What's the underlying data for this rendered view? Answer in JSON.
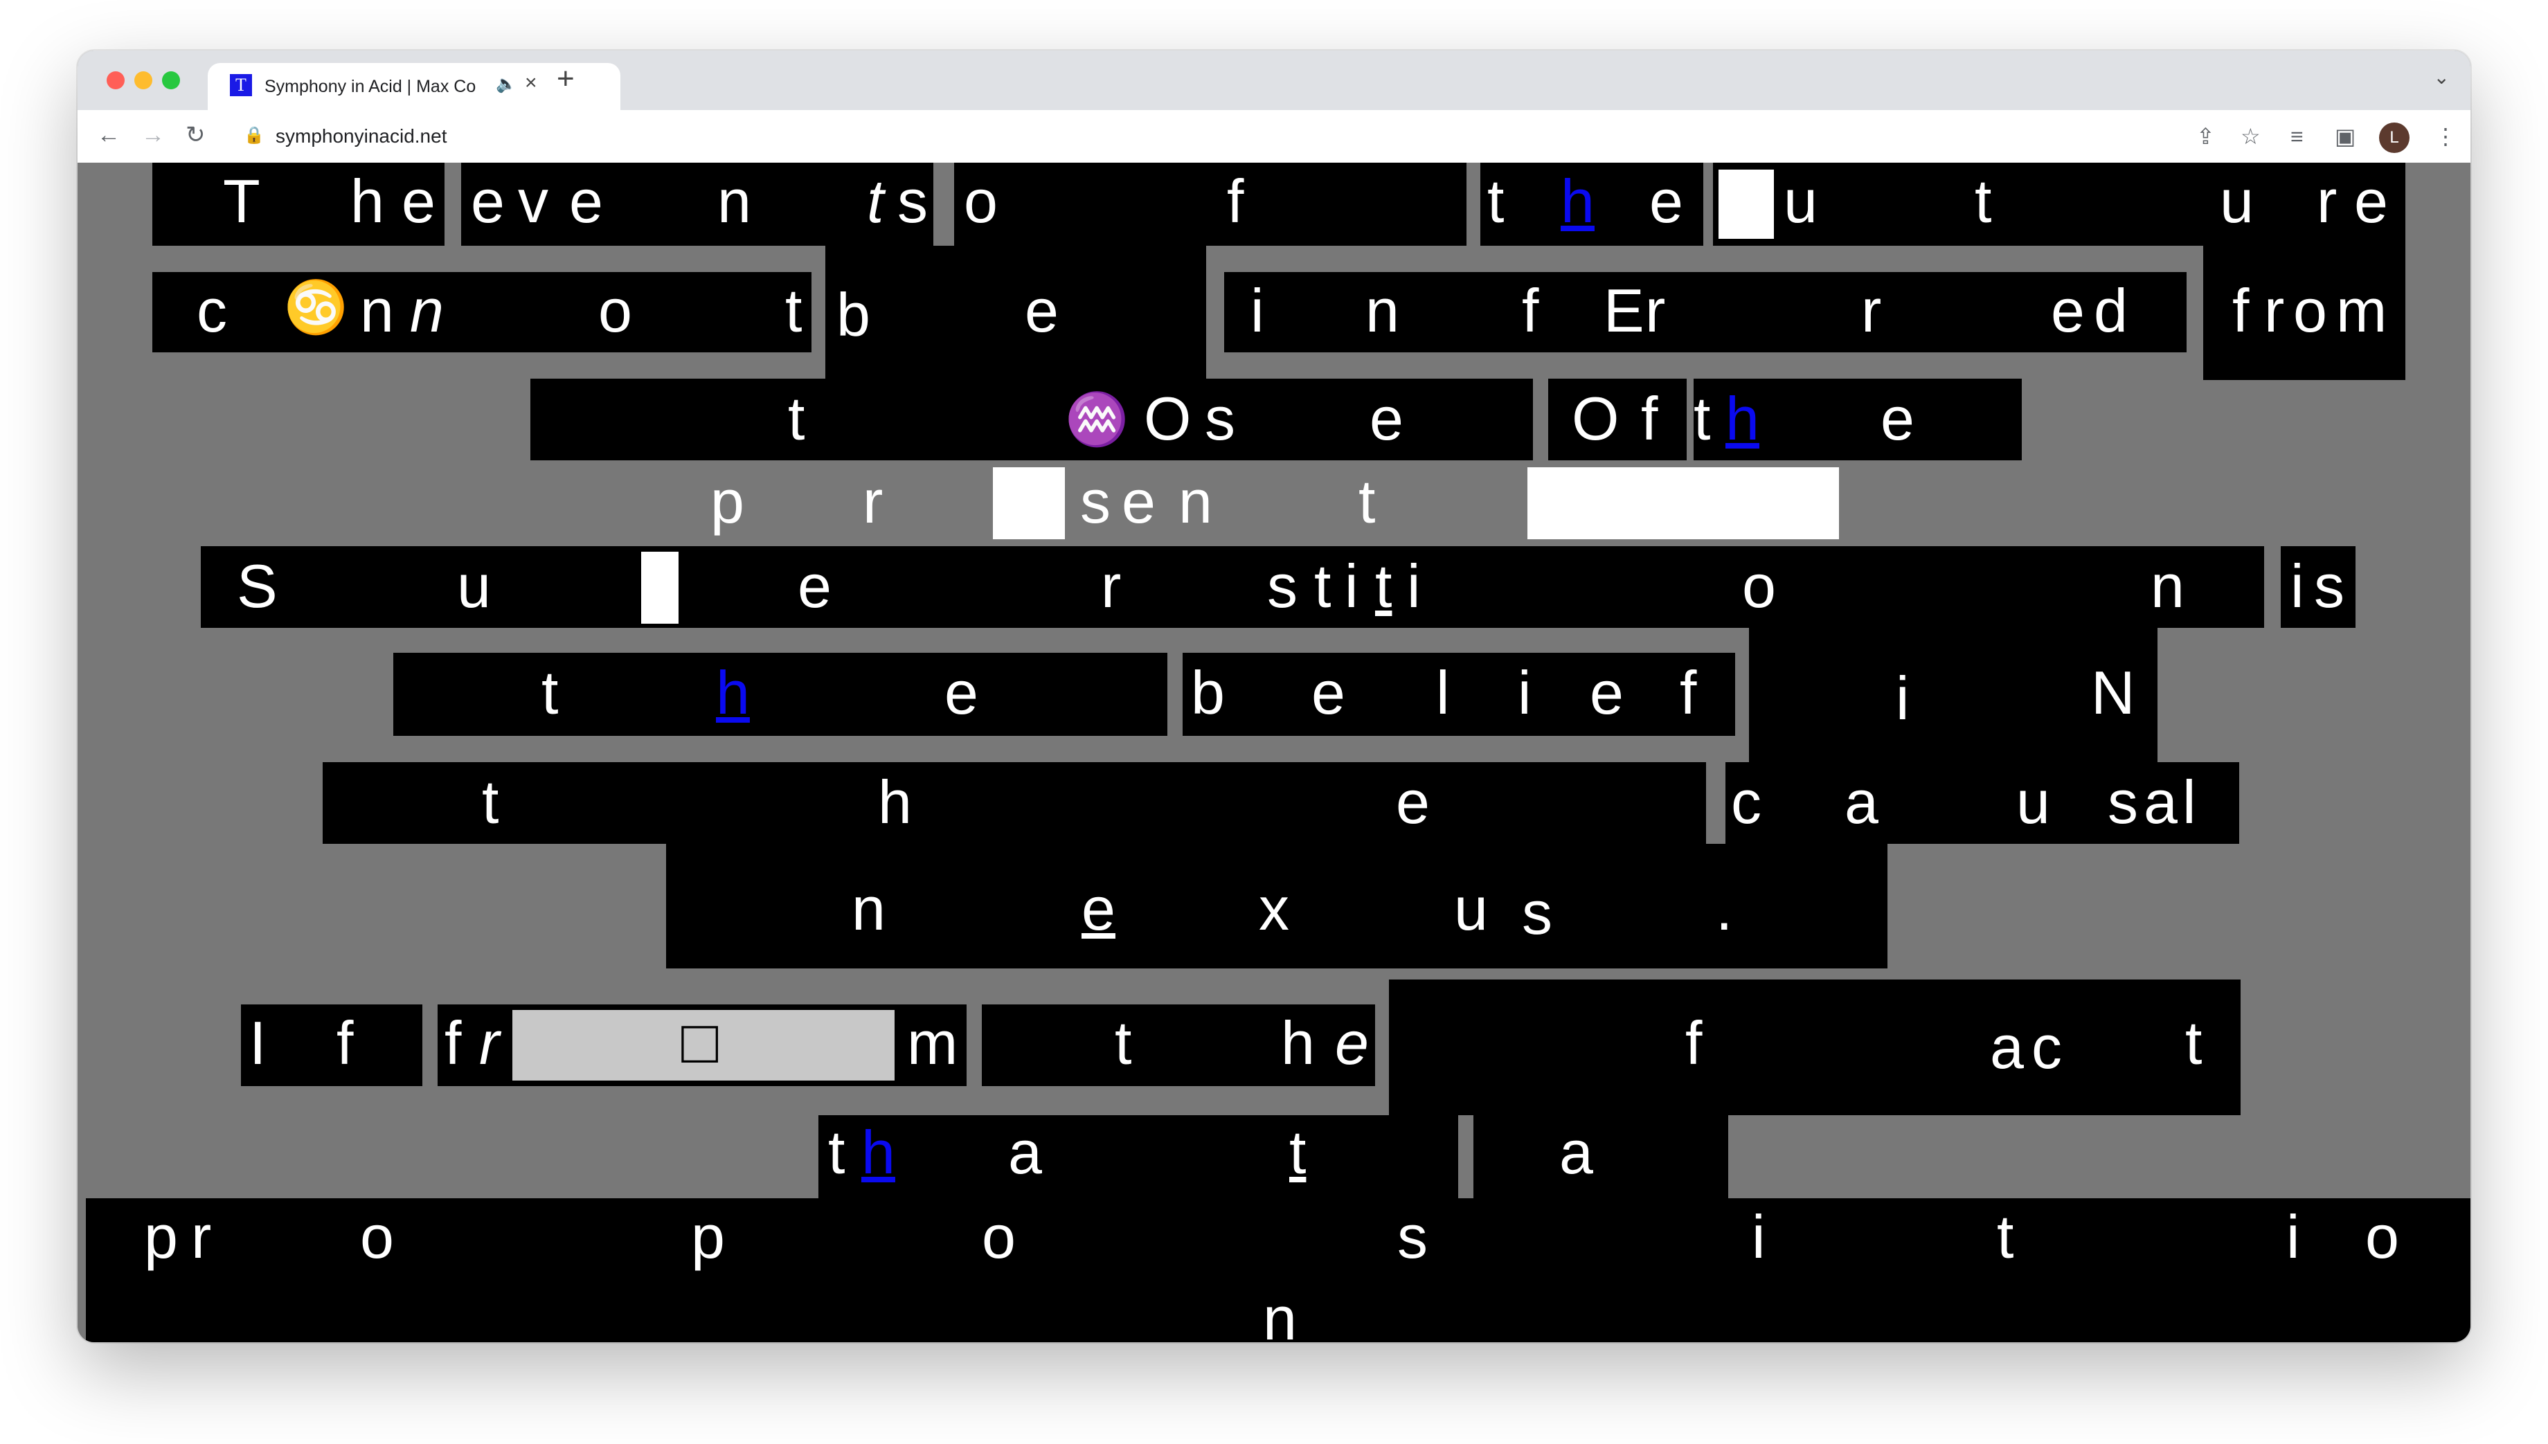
{
  "browser": {
    "tab_title": "Symphony in Acid | Max Co",
    "favicon_letter": "T",
    "url": "symphonyinacid.net",
    "profile_initial": "L"
  },
  "icons": {
    "back": "arrow-left-icon",
    "forward": "arrow-right-icon",
    "reload": "reload-icon",
    "lock": "lock-icon",
    "share": "share-icon",
    "bookmark": "star-icon",
    "media": "media-control-icon",
    "sidepanel": "side-panel-icon",
    "menu": "kebab-menu-icon",
    "audio": "speaker-icon",
    "tab_close": "close-icon",
    "new_tab": "plus-icon",
    "tab_search": "chevron-down-icon"
  },
  "colors": {
    "background": "#787878",
    "block": "#000000",
    "text": "#ffffff",
    "link": "#0a0af0",
    "input": "#c8c8c8"
  },
  "poem": {
    "lines": [
      {
        "text": "The eve n ts o f t h e u t u re",
        "words": [
          "T",
          "h",
          "e",
          "e",
          "v",
          "e",
          "n",
          "t",
          "s",
          "o",
          "f",
          "t",
          "h",
          "e",
          "u",
          "t",
          "u",
          "r",
          "e"
        ]
      },
      {
        "text": "c ♋ n n o t b e i n f Er r ed f rom",
        "words": [
          "c",
          "n",
          "n",
          "o",
          "t",
          "b",
          "e",
          "i",
          "n",
          "f",
          "E",
          "r",
          "r",
          "e",
          "d",
          "f",
          "r",
          "o",
          "m"
        ]
      },
      {
        "text": "t ♒ O s e O f t h e",
        "words": [
          "t",
          "O",
          "s",
          "e",
          "O",
          "f",
          "t",
          "h",
          "e"
        ]
      },
      {
        "text": "p r sen t",
        "words": [
          "p",
          "r",
          "s",
          "e",
          "n",
          "t"
        ]
      },
      {
        "text": "S u e r stiti o n is",
        "words": [
          "S",
          "u",
          "e",
          "r",
          "s",
          "t",
          "i",
          "t",
          "i",
          "o",
          "n",
          "i",
          "s"
        ]
      },
      {
        "text": "t h e b e l i e f i N",
        "words": [
          "t",
          "h",
          "e",
          "b",
          "e",
          "l",
          "i",
          "e",
          "f",
          "i",
          "N"
        ]
      },
      {
        "text": "t h e c a u sal",
        "words": [
          "t",
          "h",
          "e",
          "c",
          "a",
          "u",
          "s",
          "a",
          "l"
        ]
      },
      {
        "text": "n e x u s .",
        "words": [
          "n",
          "e",
          "x",
          "u",
          "s",
          "."
        ]
      },
      {
        "text": "I f fr m t he f ac t",
        "words": [
          "I",
          "f",
          "f",
          "r",
          "m",
          "t",
          "h",
          "e",
          "f",
          "a",
          "c",
          "t"
        ]
      },
      {
        "text": "th a t a",
        "words": [
          "t",
          "h",
          "a",
          "t",
          "a"
        ]
      },
      {
        "text": "pr o p o s i t i o n",
        "words": [
          "p",
          "r",
          "o",
          "p",
          "o",
          "s",
          "i",
          "t",
          "i",
          "o",
          "n"
        ]
      }
    ],
    "zodiac_cancer": "♋",
    "zodiac_aquarius": "♒",
    "checkbox_glyph": "□"
  }
}
